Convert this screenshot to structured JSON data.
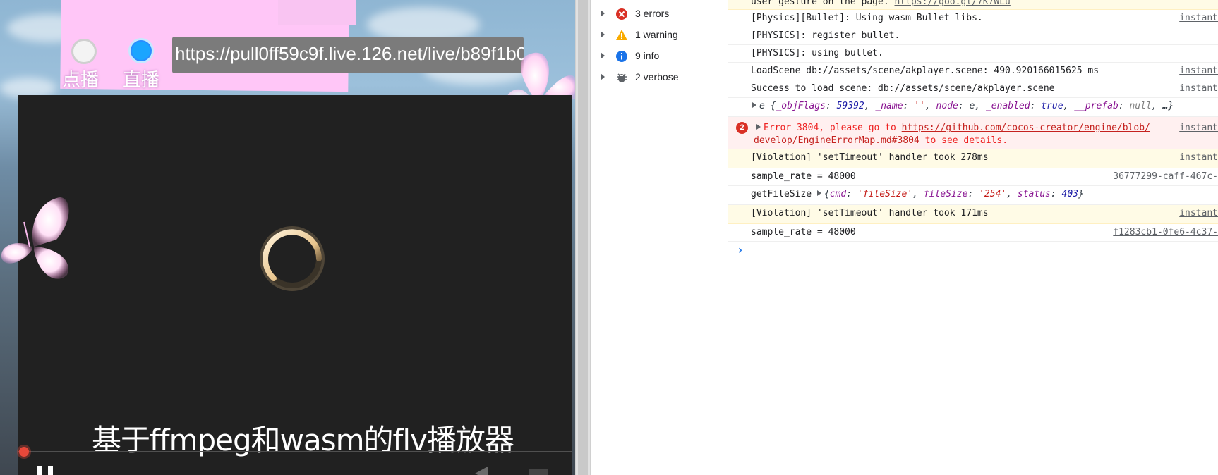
{
  "player": {
    "radio_dianbo_label": "点播",
    "radio_zhibo_label": "直播",
    "url_value": "https://pull0ff59c9f.live.126.net/live/b89f1b0",
    "subtitle": "基于ffmpeg和wasm的flv播放器",
    "progress": 0.0,
    "colors": {
      "pink_panel": "#ffc6f7",
      "selected_radio": "#1aa5ff",
      "progress_dot": "#e8483a"
    }
  },
  "sidebar": {
    "filters": [
      {
        "icon": "error-icon",
        "label": "3 errors"
      },
      {
        "icon": "warning-icon",
        "label": "1 warning"
      },
      {
        "icon": "info-icon",
        "label": "9 info"
      },
      {
        "icon": "verbose-icon",
        "label": "2 verbose"
      }
    ]
  },
  "console": {
    "row0": {
      "text": "user gesture on the page. ",
      "link": "https://goo.gl/7K7WLu"
    },
    "row1": {
      "text": "[Physics][Bullet]: Using wasm Bullet libs.",
      "source": "instant"
    },
    "row2": {
      "text": "[PHYSICS]: register bullet."
    },
    "row3": {
      "text": "[PHYSICS]: using bullet."
    },
    "row4": {
      "text": "LoadScene db://assets/scene/akplayer.scene: 490.920166015625 ms",
      "source": "instant"
    },
    "row5": {
      "text": "Success to load scene: db://assets/scene/akplayer.scene",
      "source": "instant"
    },
    "row6": {
      "prefix": "e {",
      "k1": "_objFlags",
      "v1": "59392",
      "k2": "_name",
      "v2": "''",
      "k3": "node",
      "v3": "e",
      "k4": "_enabled",
      "v4": "true",
      "k5": "__prefab",
      "v5": "null",
      "suffix": ", …}"
    },
    "row7": {
      "badge": "2",
      "text_a": "Error 3804, please go to ",
      "link_a": "https://github.com/cocos-creator/engine/blob/",
      "link_b": "develop/EngineErrorMap.md#3804",
      "text_b": " to see details.",
      "source": "instant"
    },
    "row8": {
      "text": "[Violation] 'setTimeout' handler took 278ms",
      "source": "instant"
    },
    "row9": {
      "text": "sample_rate = 48000",
      "source": "36777299-caff-467c-"
    },
    "row10": {
      "label": "getFileSize ",
      "k1": "cmd",
      "v1": "'fileSize'",
      "k2": "fileSize",
      "v2": "'254'",
      "k3": "status",
      "v3": "403"
    },
    "row11": {
      "text": "[Violation] 'setTimeout' handler took 171ms",
      "source": "instant"
    },
    "row12": {
      "text": "sample_rate = 48000",
      "source": "f1283cb1-0fe6-4c37-"
    },
    "prompt": "›"
  }
}
